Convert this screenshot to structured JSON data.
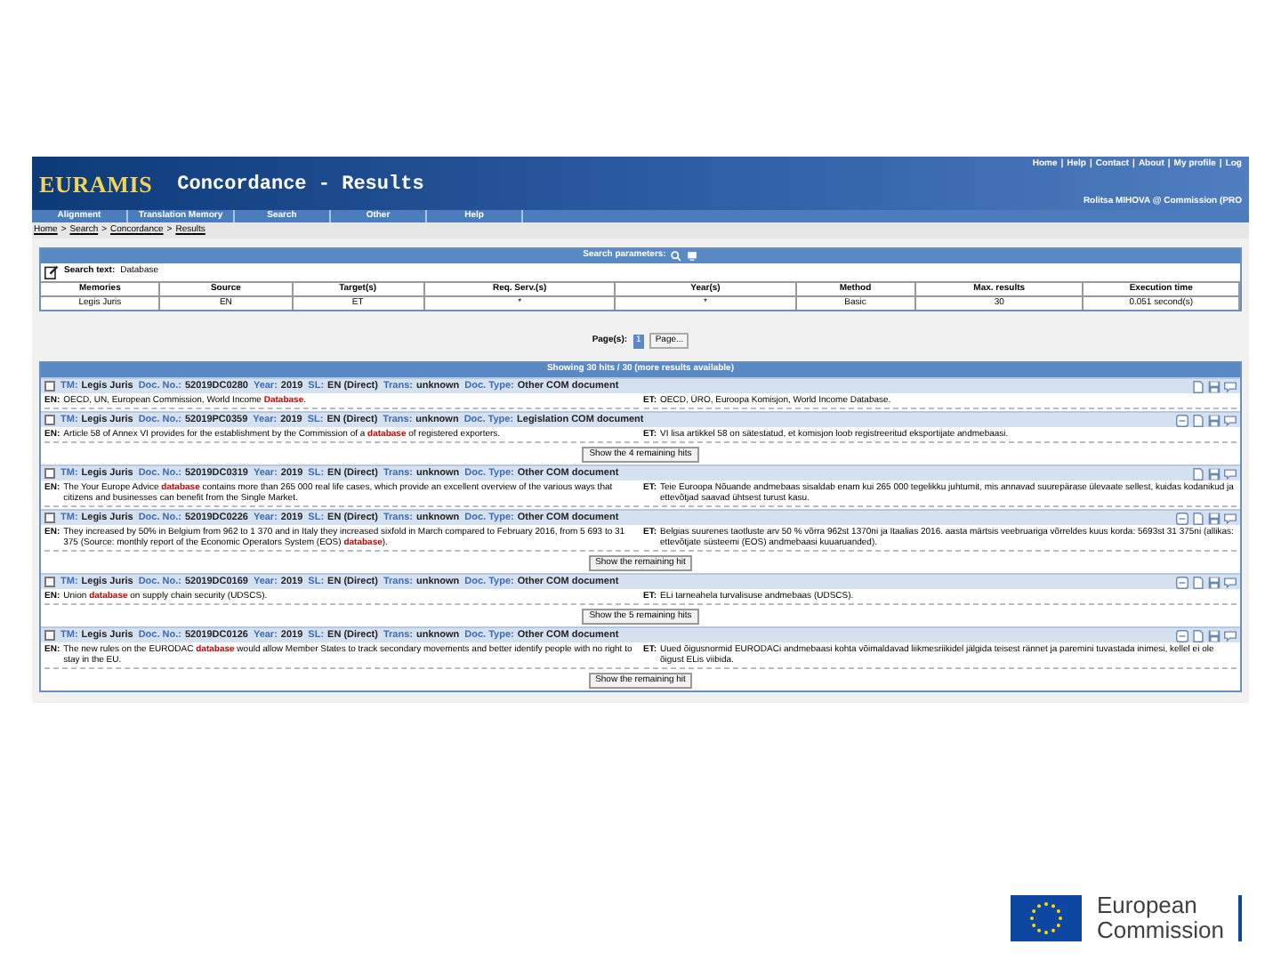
{
  "header": {
    "logo": "EURAMIS",
    "title": "Concordance - Results",
    "top_links": [
      "Home",
      "Help",
      "Contact",
      "About",
      "My profile",
      "Log"
    ],
    "link_separator": "|",
    "user": "Rolitsa MIHOVA @ Commission (PRO"
  },
  "nav": [
    "Alignment",
    "Translation Memory",
    "Search",
    "Other",
    "Help"
  ],
  "breadcrumb": {
    "items": [
      "Home",
      "Search",
      "Concordance",
      "Results"
    ],
    "separator": ">"
  },
  "search_parameters": {
    "title": "Search parameters:",
    "search_text_label": "Search text:",
    "search_text": "Database",
    "columns": [
      "Memories",
      "Source",
      "Target(s)",
      "Req. Serv.(s)",
      "Year(s)",
      "Method",
      "Max. results",
      "Execution time"
    ],
    "row": [
      "Legis Juris",
      "EN",
      "ET",
      "*",
      "*",
      "Basic",
      "30",
      "0.051 second(s)"
    ]
  },
  "paging": {
    "label": "Page(s):",
    "pages": [
      {
        "label": "1",
        "selected": true
      }
    ],
    "more": "Page..."
  },
  "results": {
    "title": "Showing 30 hits / 30 (more results available)",
    "hits": [
      {
        "checked": false,
        "collapsible": false,
        "meta": [
          {
            "label": "TM:",
            "value": "Legis Juris"
          },
          {
            "label": "Doc. No.:",
            "value": "52019DC0280"
          },
          {
            "label": "Year:",
            "value": "2019"
          },
          {
            "label": "SL:",
            "value": "EN (Direct)"
          },
          {
            "label": "Trans:",
            "value": "unknown"
          },
          {
            "label": "Doc. Type:",
            "value": "Other COM document"
          }
        ],
        "source": {
          "lang": "EN:",
          "text": "OECD, UN, European Commission, World Income **Database**."
        },
        "target": {
          "lang": "ET:",
          "text": "OECD, ÜRO, Euroopa Komisjon, World Income Database."
        }
      },
      {
        "checked": false,
        "collapsible": true,
        "meta": [
          {
            "label": "TM:",
            "value": "Legis Juris"
          },
          {
            "label": "Doc. No.:",
            "value": "52019PC0359"
          },
          {
            "label": "Year:",
            "value": "2019"
          },
          {
            "label": "SL:",
            "value": "EN (Direct)"
          },
          {
            "label": "Trans:",
            "value": "unknown"
          },
          {
            "label": "Doc. Type:",
            "value": "Legislation COM document"
          }
        ],
        "source": {
          "lang": "EN:",
          "text": "Article 58 of Annex VI provides for the establishment by the Commission of a **database** of registered exporters."
        },
        "target": {
          "lang": "ET:",
          "text": "VI lisa artikkel 58 on sätestatud, et komisjon loob registreeritud eksportijate andmebaasi."
        },
        "more_button": "Show the 4 remaining hits"
      },
      {
        "checked": false,
        "collapsible": false,
        "meta": [
          {
            "label": "TM:",
            "value": "Legis Juris"
          },
          {
            "label": "Doc. No.:",
            "value": "52019DC0319"
          },
          {
            "label": "Year:",
            "value": "2019"
          },
          {
            "label": "SL:",
            "value": "EN (Direct)"
          },
          {
            "label": "Trans:",
            "value": "unknown"
          },
          {
            "label": "Doc. Type:",
            "value": "Other COM document"
          }
        ],
        "source": {
          "lang": "EN:",
          "text": "The Your Europe Advice **database** contains more than 265 000 real life cases, which provide an excellent overview of the various ways that citizens and businesses can benefit from the Single Market."
        },
        "target": {
          "lang": "ET:",
          "text": "Teie Euroopa Nõuande andmebaas sisaldab enam kui 265 000 tegelikku juhtumit, mis annavad suurepärase ülevaate sellest, kuidas kodanikud ja ettevõtjad saavad ühtsest turust kasu."
        }
      },
      {
        "checked": false,
        "collapsible": true,
        "meta": [
          {
            "label": "TM:",
            "value": "Legis Juris"
          },
          {
            "label": "Doc. No.:",
            "value": "52019DC0226"
          },
          {
            "label": "Year:",
            "value": "2019"
          },
          {
            "label": "SL:",
            "value": "EN (Direct)"
          },
          {
            "label": "Trans:",
            "value": "unknown"
          },
          {
            "label": "Doc. Type:",
            "value": "Other COM document"
          }
        ],
        "source": {
          "lang": "EN:",
          "text": "They increased by 50% in Belgium from 962 to 1 370 and in Italy they increased sixfold in March compared to February 2016, from 5 693 to 31 375 (Source: monthly report of the Economic Operators System (EOS) **database**)."
        },
        "target": {
          "lang": "ET:",
          "text": "Belgias suurenes taotluste arv 50 % võrra 962st 1370ni ja Itaalias 2016. aasta märtsis veebruariga võrreldes kuus korda: 5693st 31 375ni (allikas: ettevõtjate süsteemi (EOS) andmebaasi kuuaruanded)."
        },
        "more_button": "Show the remaining hit"
      },
      {
        "checked": false,
        "collapsible": true,
        "meta": [
          {
            "label": "TM:",
            "value": "Legis Juris"
          },
          {
            "label": "Doc. No.:",
            "value": "52019DC0169"
          },
          {
            "label": "Year:",
            "value": "2019"
          },
          {
            "label": "SL:",
            "value": "EN (Direct)"
          },
          {
            "label": "Trans:",
            "value": "unknown"
          },
          {
            "label": "Doc. Type:",
            "value": "Other COM document"
          }
        ],
        "source": {
          "lang": "EN:",
          "text": "Union **database** on supply chain security (UDSCS)."
        },
        "target": {
          "lang": "ET:",
          "text": "ELi tarneahela turvalisuse andmebaas (UDSCS)."
        },
        "more_button": "Show the 5 remaining hits"
      },
      {
        "checked": false,
        "collapsible": true,
        "meta": [
          {
            "label": "TM:",
            "value": "Legis Juris"
          },
          {
            "label": "Doc. No.:",
            "value": "52019DC0126"
          },
          {
            "label": "Year:",
            "value": "2019"
          },
          {
            "label": "SL:",
            "value": "EN (Direct)"
          },
          {
            "label": "Trans:",
            "value": "unknown"
          },
          {
            "label": "Doc. Type:",
            "value": "Other COM document"
          }
        ],
        "source": {
          "lang": "EN:",
          "text": "The new rules on the EURODAC **database** would allow Member States to track secondary movements and better identify people with no right to stay in the EU."
        },
        "target": {
          "lang": "ET:",
          "text": "Uued õigusnormid EURODACi andmebaasi kohta võimaldavad liikmesriikidel jälgida teisest rännet ja paremini tuvastada inimesi, kellel ei ole õigust ELis viibida."
        },
        "more_button": "Show the remaining hit"
      }
    ]
  },
  "footer_logo": {
    "line1": "European",
    "line2": "Commission"
  }
}
